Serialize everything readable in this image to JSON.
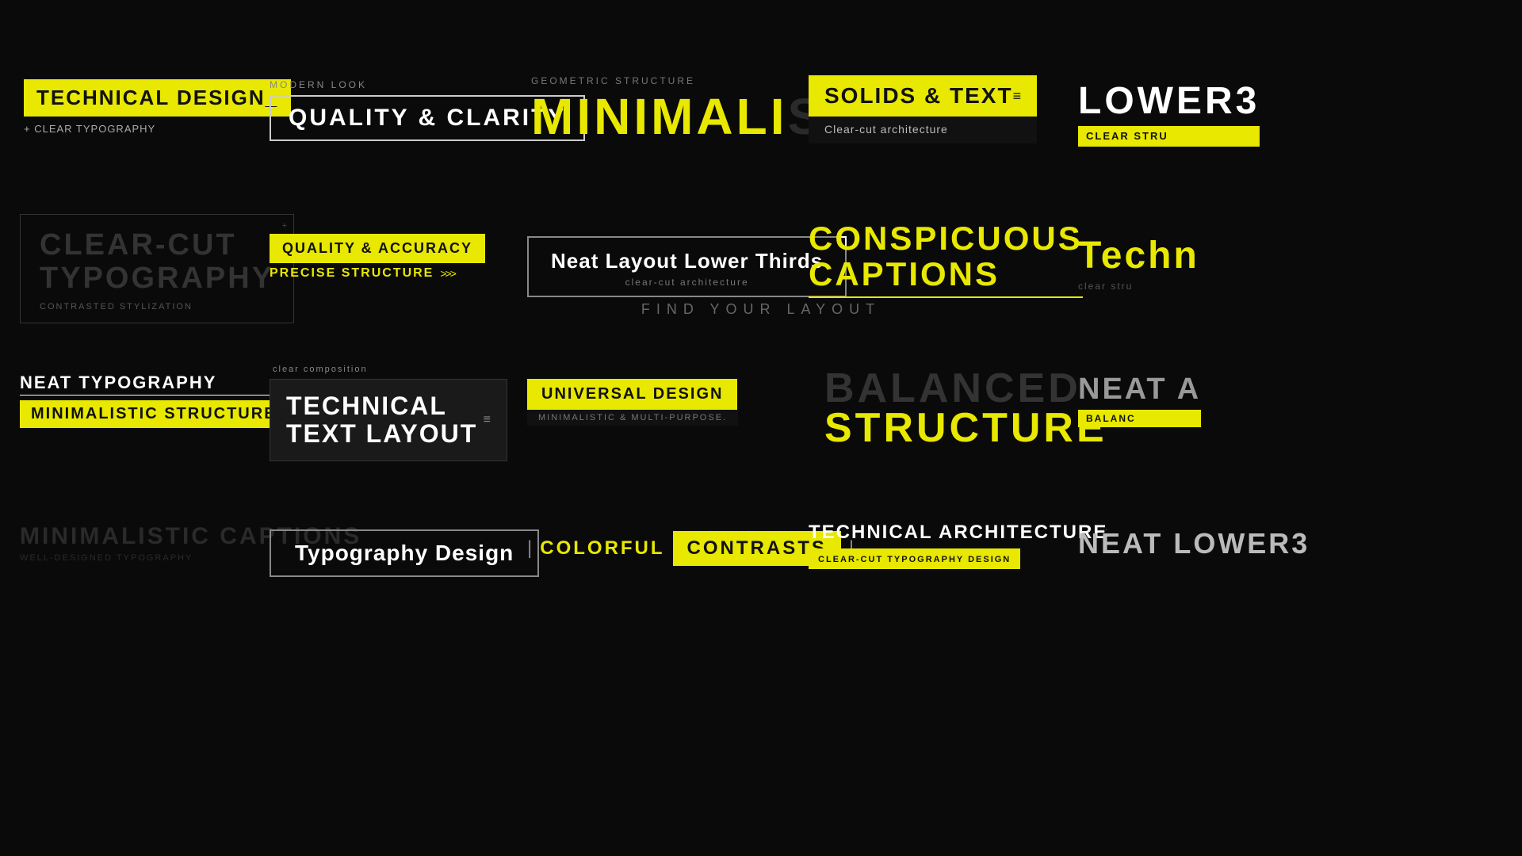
{
  "bg": "#0a0a0a",
  "accent": "#e8e800",
  "cards": {
    "techDesign": {
      "main": "TECHNICAL DESIGN_",
      "sub": "+ CLEAR TYPOGRAPHY"
    },
    "qualityClarity": {
      "label": "MODERN LOOK",
      "main": "QUALITY & CLARITY"
    },
    "geometric": {
      "label": "GEOMETRIC STRUCTURE",
      "main": "MINIMALI",
      "fade": "STIC"
    },
    "solidsText": {
      "main": "SOLIDS & TEXT",
      "sub": "Clear-cut architecture",
      "menuIcon": "≡"
    },
    "lower3": {
      "main": "LOWER3",
      "sub": "CLEAR STRU"
    },
    "clearCut": {
      "main": "CLEAR-CUT\nTYPOGRAPHY",
      "sub": "CONTRASTED STYLIZATION",
      "corner": "+"
    },
    "qualityAccuracy": {
      "row1": "QUALITY & ACCURACY",
      "row2": "PRECISE STRUCTURE",
      "arrows": ">>>"
    },
    "neatLayout": {
      "main": "Neat Layout Lower Thirds",
      "sub": "clear-cut architecture"
    },
    "findLayout": "FIND YOUR LAYOUT",
    "conspicuous": {
      "line1": "CONSPICUOUS",
      "line2": "CAPTIONS"
    },
    "technPartial": {
      "main": "Techn",
      "sub": "clear stru"
    },
    "neatTypo": {
      "line": "NEAT TYPOGRAPHY",
      "yellow": "MINIMALISTIC STRUCTURE"
    },
    "techTextLayout": {
      "label": "clear composition",
      "main": "TECHNICAL\nTEXT LAYOUT",
      "menuIcon": "≡"
    },
    "universalDesign": {
      "main": "UNIVERSAL DESIGN",
      "sub": "MINIMALISTIC & MULTI-PURPOSE."
    },
    "balanced": {
      "top": "BALANCED",
      "main": "STRUCTURE"
    },
    "neatPartial": {
      "main": "NEAT A",
      "yellow": "BALANC"
    },
    "minCaptions": {
      "main": "MINIMALISTIC CAPTIONS",
      "sub": "WELL-DESIGNED TYPOGRAPHY"
    },
    "typoDes": {
      "main": "Typography Design"
    },
    "colorfulContrasts": {
      "label": "COLORFUL",
      "contrast": "CONTRASTS"
    },
    "techArch": {
      "main": "TECHNICAL ARCHITECTURE",
      "sub": "CLEAR-CUT TYPOGRAPHY DESIGN",
      "dots": "..."
    },
    "neatLower3": {
      "main": "NEAT LOWER3"
    }
  }
}
